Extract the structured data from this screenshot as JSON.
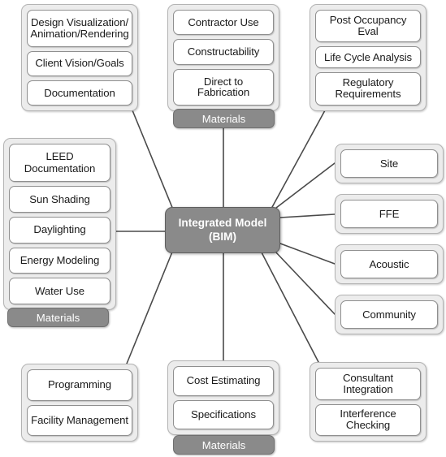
{
  "diagram": {
    "title": "Integrated Model (BIM) relationship diagram",
    "center": {
      "label": "Integrated Model\n(BIM)",
      "line1": "Integrated Model",
      "line2": "(BIM)",
      "fill": "#8a8a8a",
      "text_color": "#ffffff"
    },
    "materials_tab_label": "Materials",
    "colors": {
      "group_fill": "#ececec",
      "group_border": "#b4b4b4",
      "item_fill": "#ffffff",
      "item_border": "#8f8f8f",
      "accent_gray": "#8a8a8a",
      "connector": "#4a4a4a",
      "page_background": "#ffffff",
      "text": "#1a1a1a"
    },
    "groups": [
      {
        "id": "design",
        "name": "design-group",
        "items": [
          "Design Visualization/\nAnimation/Rendering",
          "Client Vision/Goals",
          "Documentation"
        ],
        "has_materials_tab": false
      },
      {
        "id": "construction",
        "name": "construction-group",
        "items": [
          "Contractor Use",
          "Constructability",
          "Direct to Fabrication"
        ],
        "has_materials_tab": true
      },
      {
        "id": "evaluation",
        "name": "evaluation-group",
        "items": [
          "Post Occupancy Eval",
          "Life Cycle Analysis",
          "Regulatory\nRequirements"
        ],
        "has_materials_tab": false
      },
      {
        "id": "sustainability",
        "name": "sustainability-group",
        "items": [
          "LEED\nDocumentation",
          "Sun Shading",
          "Daylighting",
          "Energy Modeling",
          "Water Use"
        ],
        "has_materials_tab": true
      },
      {
        "id": "management",
        "name": "management-group",
        "items": [
          "Programming",
          "Facility Management"
        ],
        "has_materials_tab": false
      },
      {
        "id": "cost",
        "name": "cost-group",
        "items": [
          "Cost Estimating",
          "Specifications"
        ],
        "has_materials_tab": true
      },
      {
        "id": "coordination",
        "name": "coordination-group",
        "items": [
          "Consultant\nIntegration",
          "Interference\nChecking"
        ],
        "has_materials_tab": false
      },
      {
        "id": "site",
        "name": "site-group",
        "items": [
          "Site"
        ],
        "has_materials_tab": false
      },
      {
        "id": "ffe",
        "name": "ffe-group",
        "items": [
          "FFE"
        ],
        "has_materials_tab": false
      },
      {
        "id": "acoustic",
        "name": "acoustic-group",
        "items": [
          "Acoustic"
        ],
        "has_materials_tab": false
      },
      {
        "id": "community",
        "name": "community-group",
        "items": [
          "Community"
        ],
        "has_materials_tab": false
      }
    ]
  }
}
